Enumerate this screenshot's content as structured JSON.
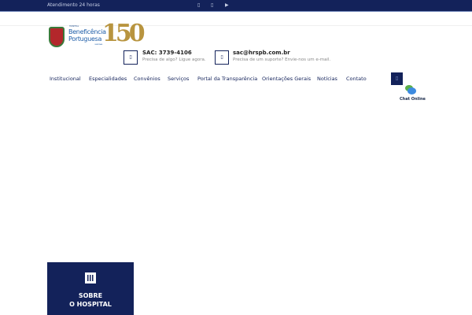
{
  "topbar": {
    "attendance": " Atendimento 24 horas",
    "social": [
      "facebook-icon",
      "instagram-icon",
      "youtube-icon"
    ]
  },
  "logo": {
    "small": "HOSPITAL",
    "line1": "Beneficência",
    "line2": "Portuguesa",
    "city": "CAMPINAS",
    "anniversary": "150"
  },
  "contacts": [
    {
      "title": "SAC: 3739-4106",
      "subtitle": "Precisa de algo? Ligue agora.",
      "icon": "phone-icon"
    },
    {
      "title": "sac@hrspb.com.br",
      "subtitle": "Precisa de um suporte? Envie-nos um e-mail.",
      "icon": "mail-icon"
    }
  ],
  "nav": [
    "Institucional",
    "Especialidades",
    "Convênios",
    "Serviços",
    "Portal da Transparência",
    "Orientações Gerais",
    "Notícias",
    "Contato"
  ],
  "chat": {
    "label": "Chat Online"
  },
  "card": {
    "line1": "SOBRE",
    "line2": "O HOSPITAL"
  },
  "colors": {
    "navy": "#13225a",
    "gold": "#b8943f"
  }
}
